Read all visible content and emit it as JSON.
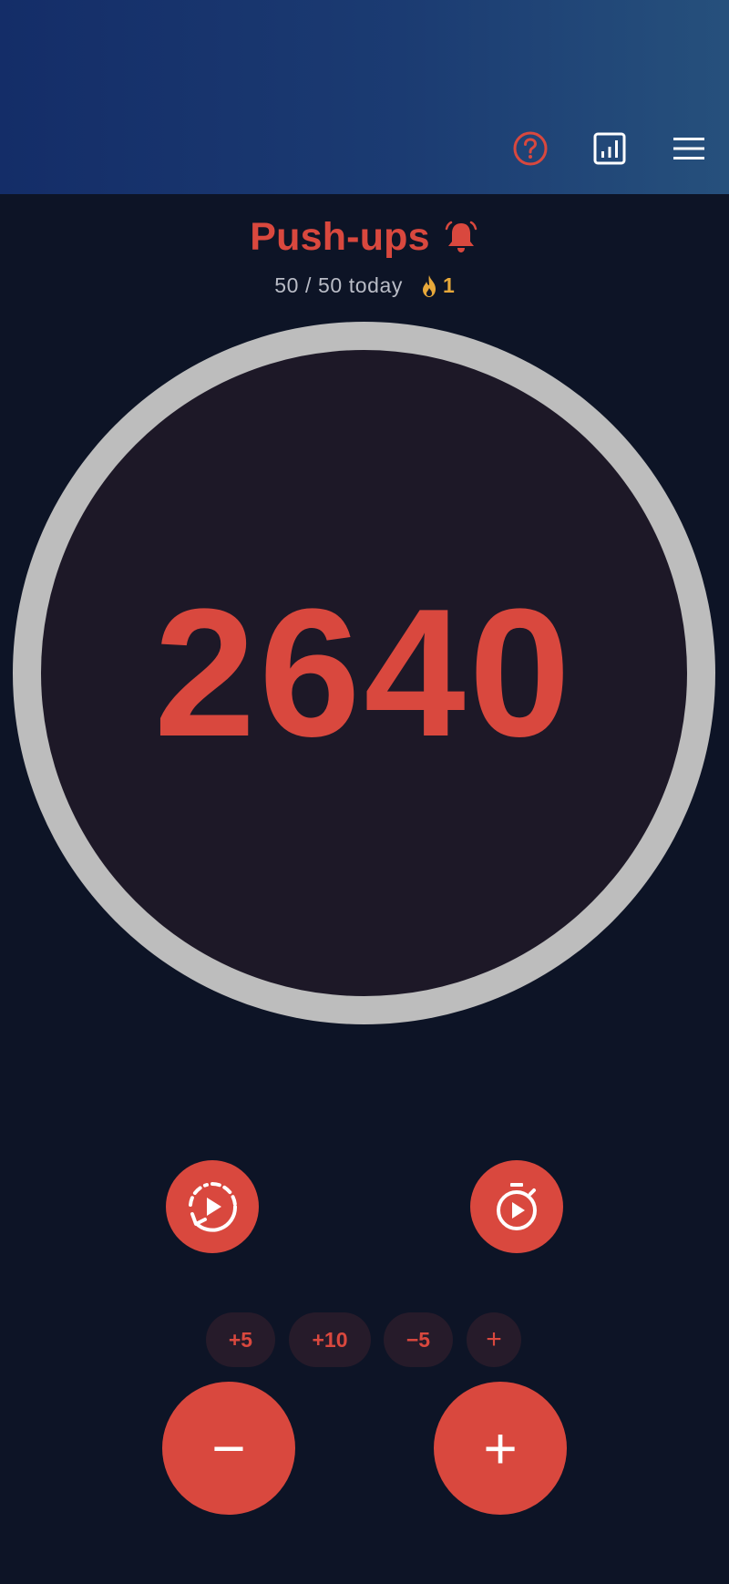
{
  "header": {
    "help_icon": "help-circle-icon",
    "stats_icon": "bar-chart-icon",
    "menu_icon": "hamburger-menu-icon"
  },
  "exercise": {
    "name": "Push-ups",
    "reminder_icon": "bell-icon",
    "today_progress": "50 / 50 today",
    "streak_icon": "flame-icon",
    "streak_count": "1"
  },
  "counter": {
    "value": "2640",
    "ring_progress_fraction": 1.0
  },
  "actions": {
    "auto_repeat_icon": "repeat-play-icon",
    "timer_icon": "stopwatch-play-icon"
  },
  "quick_adjust": [
    "+5",
    "+10",
    "−5",
    "+"
  ],
  "steppers": {
    "decrement_label": "−",
    "increment_label": "+"
  },
  "colors": {
    "accent": "#d9483e",
    "background": "#0d1426",
    "ring": "#bdbdbd",
    "ring_inner": "#1d1827",
    "streak": "#e7a83a",
    "header_gradient_start": "#142d68",
    "header_gradient_end": "#26507c"
  }
}
